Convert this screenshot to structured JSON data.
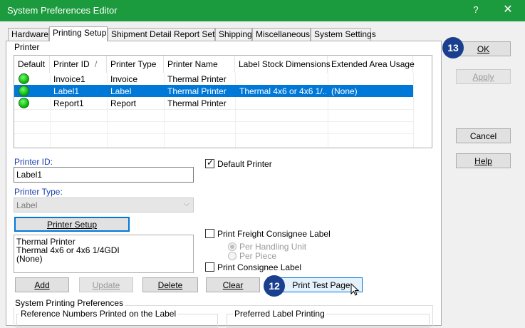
{
  "window": {
    "title": "System Preferences Editor",
    "help_glyph": "?",
    "close_glyph": "✕"
  },
  "tabs": [
    "Hardware",
    "Printing Setup",
    "Shipment Detail Report Setup",
    "Shipping",
    "Miscellaneous",
    "System Settings"
  ],
  "printer_section": {
    "title": "Printer",
    "columns": [
      "Default",
      "Printer ID",
      "Printer Type",
      "Printer Name",
      "Label Stock Dimensions",
      "Extended Area Usage"
    ],
    "sort_glyph": "/",
    "rows": [
      {
        "id": "Invoice1",
        "type": "Invoice",
        "name": "Thermal Printer",
        "stock": "",
        "extended": ""
      },
      {
        "id": "Label1",
        "type": "Label",
        "name": "Thermal Printer",
        "stock": "Thermal 4x6 or 4x6 1/...",
        "extended": "(None)"
      },
      {
        "id": "Report1",
        "type": "Report",
        "name": "Thermal Printer",
        "stock": "",
        "extended": ""
      }
    ]
  },
  "form": {
    "printer_id_label": "Printer ID:",
    "printer_id_value": "Label1",
    "printer_type_label": "Printer Type:",
    "printer_type_value": "Label",
    "printer_setup_button": "Printer Setup",
    "info_lines": [
      "Thermal Printer",
      "Thermal 4x6 or 4x6 1/4GDI",
      "(None)"
    ],
    "default_printer_label": "Default Printer",
    "freight_consignee_label": "Print Freight Consignee Label",
    "per_handling_unit_label": "Per Handling Unit",
    "per_piece_label": "Per Piece",
    "print_consignee_label": "Print Consignee Label"
  },
  "buttons": {
    "add": "Add",
    "update": "Update",
    "delete": "Delete",
    "clear": "Clear",
    "print_test_page": "Print Test Page",
    "ok": "OK",
    "apply": "Apply",
    "cancel": "Cancel",
    "help": "Help"
  },
  "system_printing": {
    "title": "System Printing Preferences",
    "reference_group": "Reference Numbers Printed on the Label",
    "preferred_group": "Preferred Label Printing"
  },
  "badges": {
    "ok_badge": "13",
    "print_badge": "12"
  },
  "colors": {
    "title_bar": "#1c9a3e",
    "selection": "#0078d7",
    "badge": "#1a3f8f",
    "status_dot": "#00c000"
  }
}
